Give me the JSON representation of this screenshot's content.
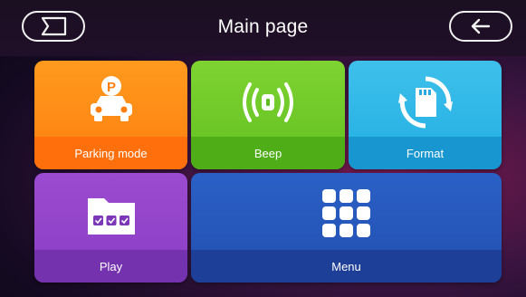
{
  "header": {
    "title": "Main page",
    "left_icon": "screen-toggle-icon",
    "right_icon": "back-arrow-icon"
  },
  "tiles": {
    "parking": {
      "label": "Parking mode",
      "icon": "car-parking-icon",
      "color": "#ff8a14"
    },
    "beep": {
      "label": "Beep",
      "icon": "beep-signal-icon",
      "color": "#6cc626"
    },
    "format": {
      "label": "Format",
      "icon": "sd-card-format-icon",
      "color": "#2db4e6"
    },
    "play": {
      "label": "Play",
      "icon": "folder-play-icon",
      "color": "#8c40c6"
    },
    "menu": {
      "label": "Menu",
      "icon": "grid-menu-icon",
      "color": "#2657b8"
    }
  }
}
